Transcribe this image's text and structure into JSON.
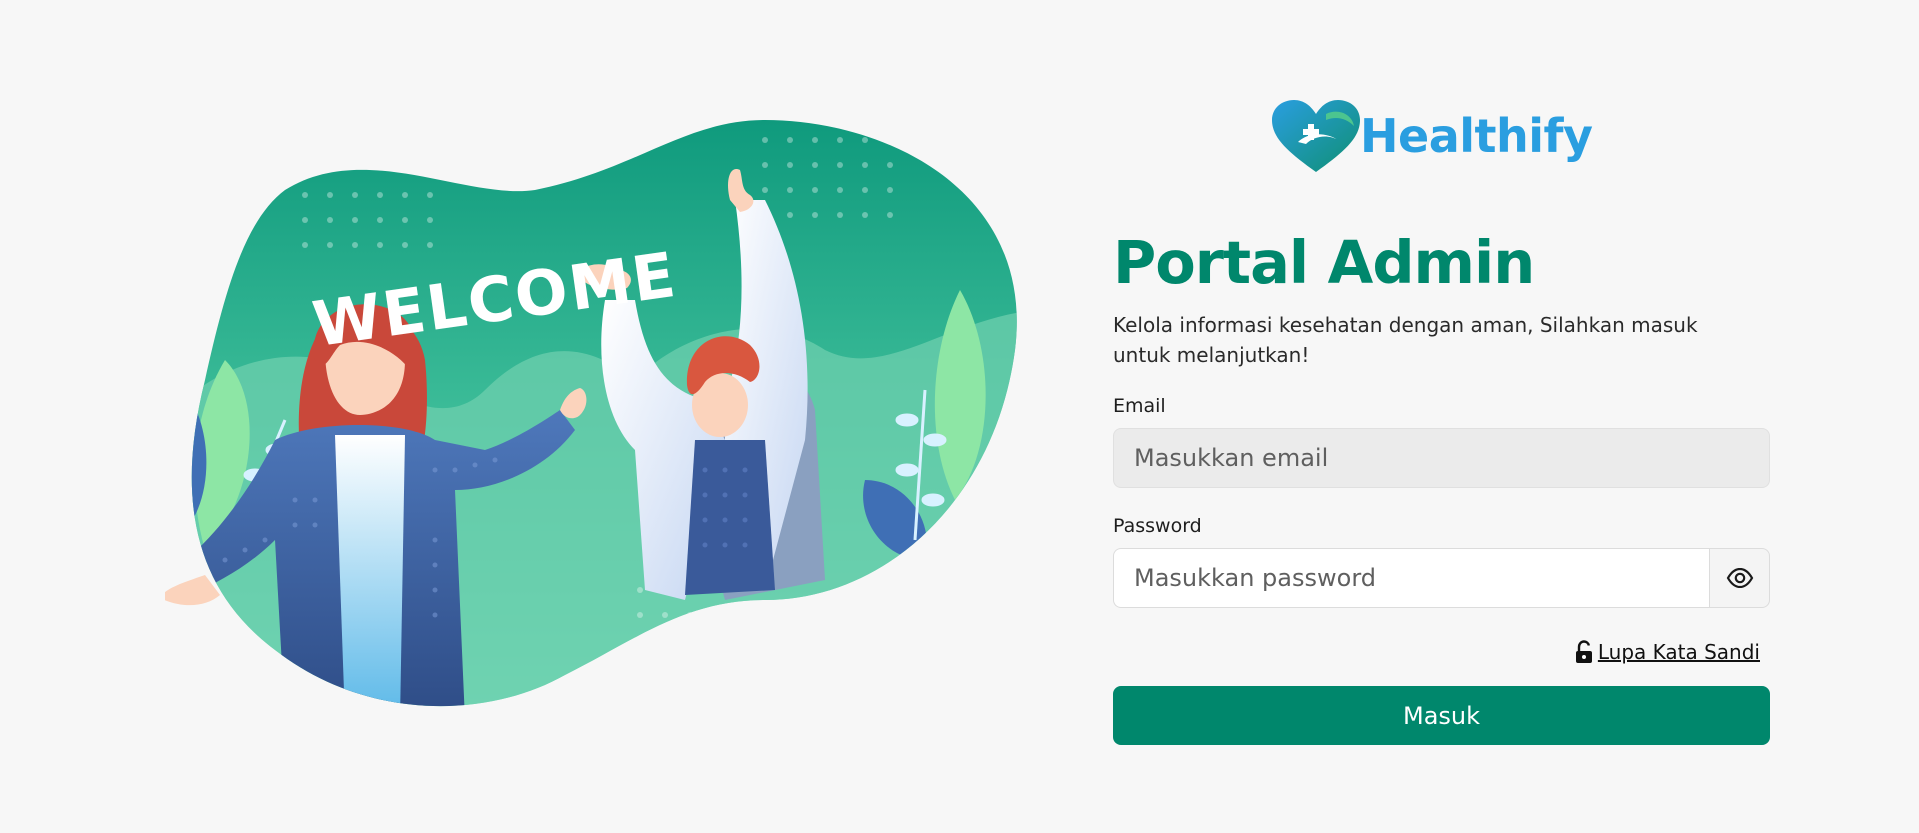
{
  "brand": {
    "name": "Healthify",
    "color": "#2a9ee0"
  },
  "illustration": {
    "banner_text": "WELCOME"
  },
  "form": {
    "title": "Portal Admin",
    "subtitle": "Kelola informasi kesehatan dengan aman, Silahkan masuk untuk melanjutkan!",
    "email": {
      "label": "Email",
      "placeholder": "Masukkan email",
      "value": ""
    },
    "password": {
      "label": "Password",
      "placeholder": "Masukkan password",
      "value": "",
      "toggle_icon": "eye-icon"
    },
    "forgot": {
      "label": "Lupa Kata Sandi",
      "icon": "unlock-icon"
    },
    "submit_label": "Masuk"
  },
  "colors": {
    "primary": "#00876c",
    "background": "#f7f7f7",
    "input_fill": "#ebebeb"
  }
}
